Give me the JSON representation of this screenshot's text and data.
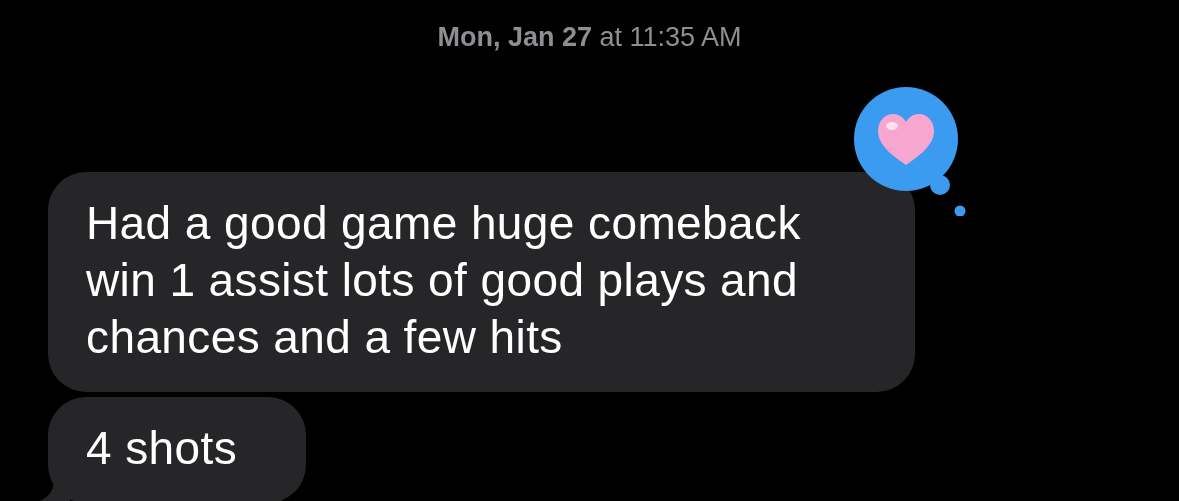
{
  "timestamp": "**Mon, Jan 27** at 11:35 AM",
  "messages": [
    {
      "text": "Had a good game huge comeback win 1 assist lots of good plays and chances and a few hits",
      "tapback": true,
      "tail": false
    },
    {
      "text": "4 shots",
      "tapback": false,
      "tail": true
    }
  ]
}
